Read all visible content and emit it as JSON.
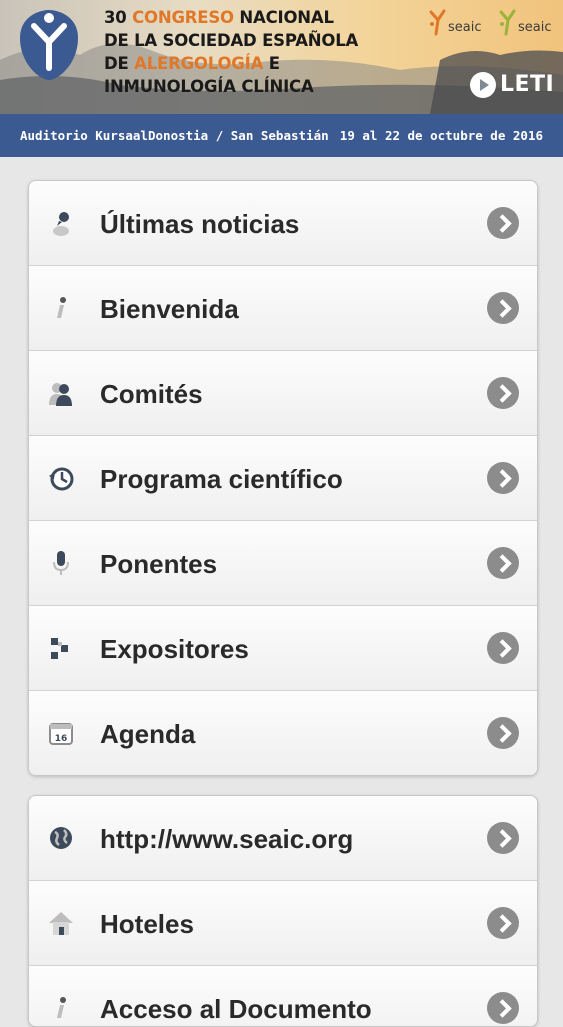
{
  "banner": {
    "title_lines": [
      {
        "pre": "30 ",
        "hl": "CONGRESO",
        "post": " NACIONAL"
      },
      {
        "pre": "DE LA SOCIEDAD ESPAÑOLA",
        "hl": "",
        "post": ""
      },
      {
        "pre": "DE ",
        "hl": "ALERGOLOGÍA",
        "post": " E"
      },
      {
        "pre": "INMUNOLOGÍA CLÍNICA",
        "hl": "",
        "post": ""
      }
    ],
    "sponsor_1": "seaic",
    "sponsor_2": "seaic",
    "leti": "LETI",
    "accent_color": "#e0782a"
  },
  "venue": {
    "place": "Auditorio Kursaal",
    "city": "Donostia / San Sebastián",
    "dates": "19 al 22 de octubre de 2016"
  },
  "menu_primary": [
    {
      "label": "Últimas noticias",
      "icon": "news-icon"
    },
    {
      "label": "Bienvenida",
      "icon": "info-icon"
    },
    {
      "label": "Comités",
      "icon": "people-icon"
    },
    {
      "label": "Programa científico",
      "icon": "clock-icon"
    },
    {
      "label": "Ponentes",
      "icon": "microphone-icon"
    },
    {
      "label": "Expositores",
      "icon": "exhibitors-icon"
    },
    {
      "label": "Agenda",
      "icon": "calendar-icon"
    }
  ],
  "menu_secondary": [
    {
      "label": "http://www.seaic.org",
      "icon": "globe-icon"
    },
    {
      "label": "Hoteles",
      "icon": "home-icon"
    },
    {
      "label": "Acceso al Documento",
      "icon": "info-icon"
    }
  ],
  "calendar_day": "16",
  "colors": {
    "venue_bar": "#3c5a92",
    "chevron": "#8c8c8c",
    "background": "#e7e7e7"
  }
}
